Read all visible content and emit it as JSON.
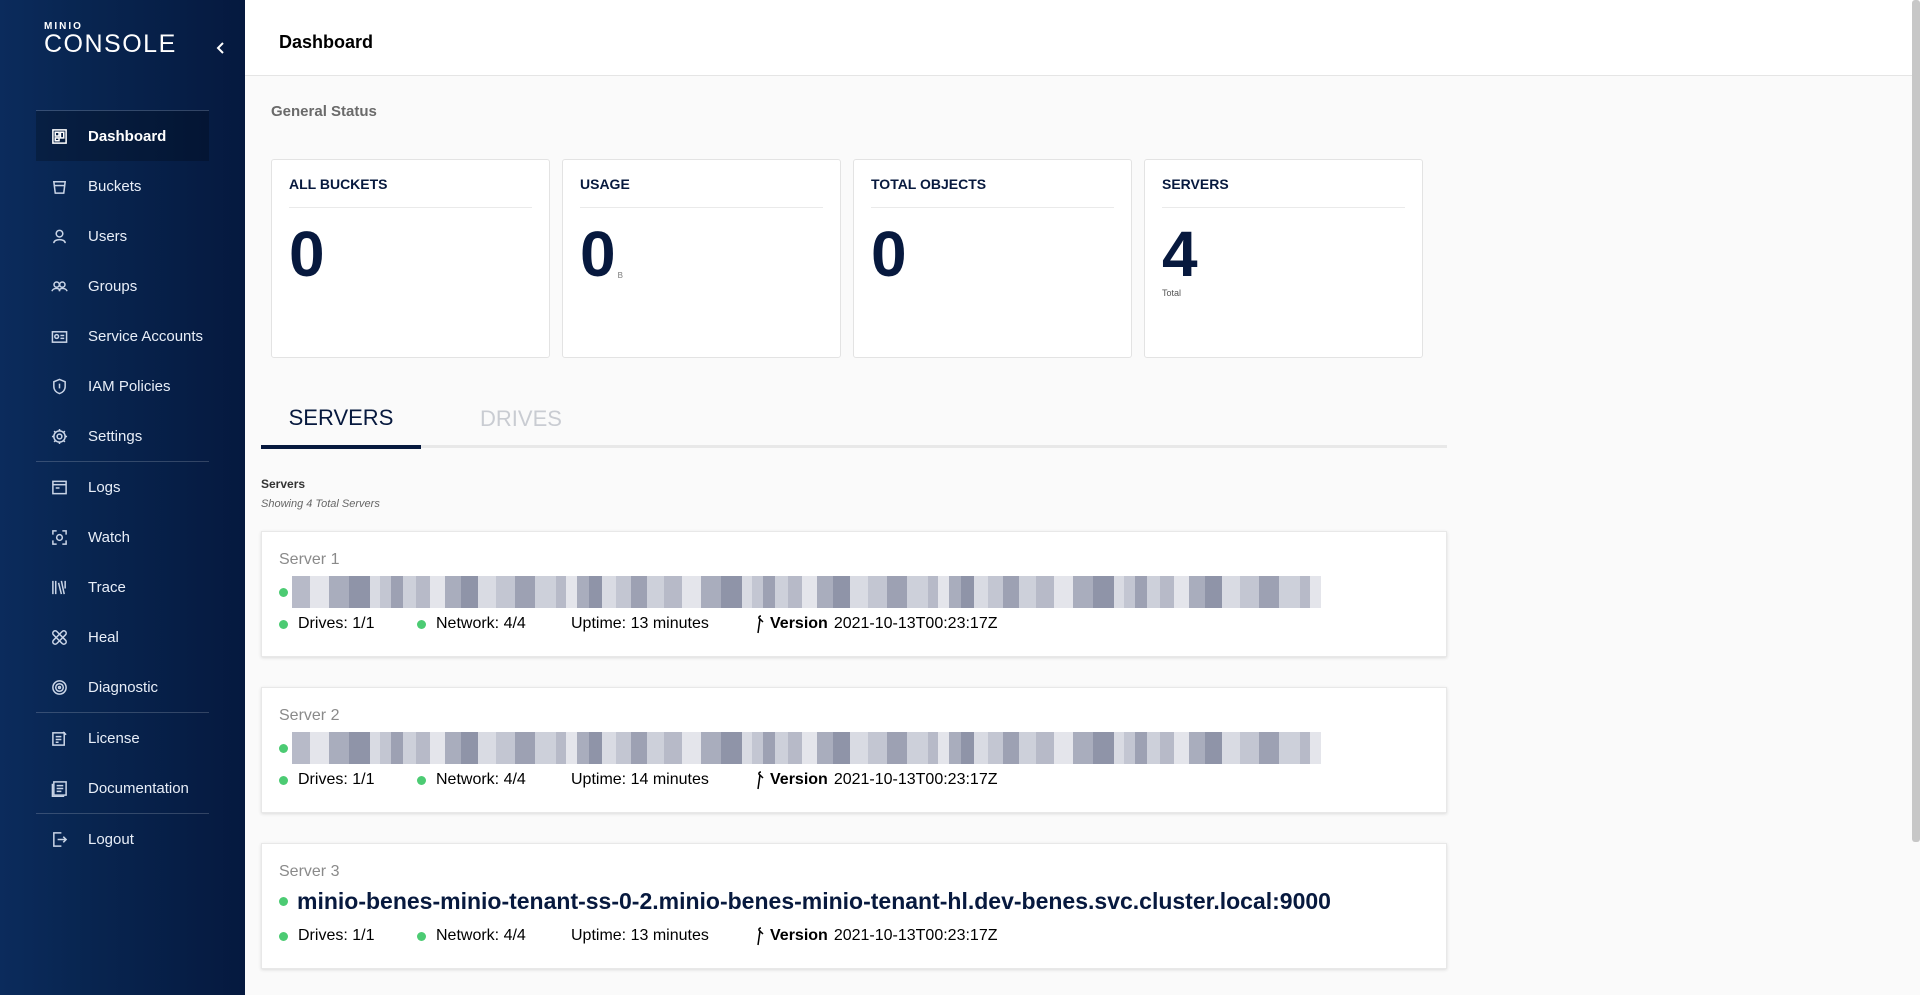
{
  "brand": {
    "mini": "MINIO",
    "console": "CONSOLE"
  },
  "colors": {
    "sidebar": "#082550",
    "accent": "#07193e",
    "status_ok": "#4ccb73"
  },
  "sidebar": {
    "collapse_icon": "chevron-left-icon",
    "items": [
      {
        "label": "Dashboard",
        "icon": "dashboard-icon",
        "active": true
      },
      {
        "label": "Buckets",
        "icon": "bucket-icon"
      },
      {
        "label": "Users",
        "icon": "user-icon"
      },
      {
        "label": "Groups",
        "icon": "groups-icon"
      },
      {
        "label": "Service Accounts",
        "icon": "service-accounts-icon"
      },
      {
        "label": "IAM Policies",
        "icon": "shield-icon"
      },
      {
        "label": "Settings",
        "icon": "gear-icon"
      },
      {
        "label": "Logs",
        "icon": "logs-icon"
      },
      {
        "label": "Watch",
        "icon": "watch-icon"
      },
      {
        "label": "Trace",
        "icon": "trace-icon"
      },
      {
        "label": "Heal",
        "icon": "heal-icon"
      },
      {
        "label": "Diagnostic",
        "icon": "diagnostic-icon"
      },
      {
        "label": "License",
        "icon": "license-icon"
      },
      {
        "label": "Documentation",
        "icon": "documentation-icon"
      },
      {
        "label": "Logout",
        "icon": "logout-icon"
      }
    ]
  },
  "header": {
    "title": "Dashboard"
  },
  "general_status": {
    "label": "General Status",
    "cards": [
      {
        "label": "ALL BUCKETS",
        "value": "0",
        "unit": "",
        "sub": ""
      },
      {
        "label": "USAGE",
        "value": "0",
        "unit": "B",
        "sub": ""
      },
      {
        "label": "TOTAL OBJECTS",
        "value": "0",
        "unit": "",
        "sub": ""
      },
      {
        "label": "SERVERS",
        "value": "4",
        "unit": "",
        "sub": "Total"
      }
    ]
  },
  "tabs": [
    {
      "label": "SERVERS",
      "active": true
    },
    {
      "label": "DRIVES",
      "active": false
    }
  ],
  "servers_list": {
    "title": "Servers",
    "subtitle": "Showing 4 Total Servers",
    "items": [
      {
        "name": "Server 1",
        "endpoint": "",
        "endpoint_redacted": true,
        "drives": "Drives: 1/1",
        "network": "Network: 4/4",
        "uptime": "Uptime: 13 minutes",
        "version_label": "Version",
        "version": "2021-10-13T00:23:17Z"
      },
      {
        "name": "Server 2",
        "endpoint": "",
        "endpoint_redacted": true,
        "drives": "Drives: 1/1",
        "network": "Network: 4/4",
        "uptime": "Uptime: 14 minutes",
        "version_label": "Version",
        "version": "2021-10-13T00:23:17Z"
      },
      {
        "name": "Server 3",
        "endpoint": "minio-benes-minio-tenant-ss-0-2.minio-benes-minio-tenant-hl.dev-benes.svc.cluster.local:9000",
        "endpoint_redacted": false,
        "drives": "Drives: 1/1",
        "network": "Network: 4/4",
        "uptime": "Uptime: 13 minutes",
        "version_label": "Version",
        "version": "2021-10-13T00:23:17Z"
      }
    ]
  }
}
